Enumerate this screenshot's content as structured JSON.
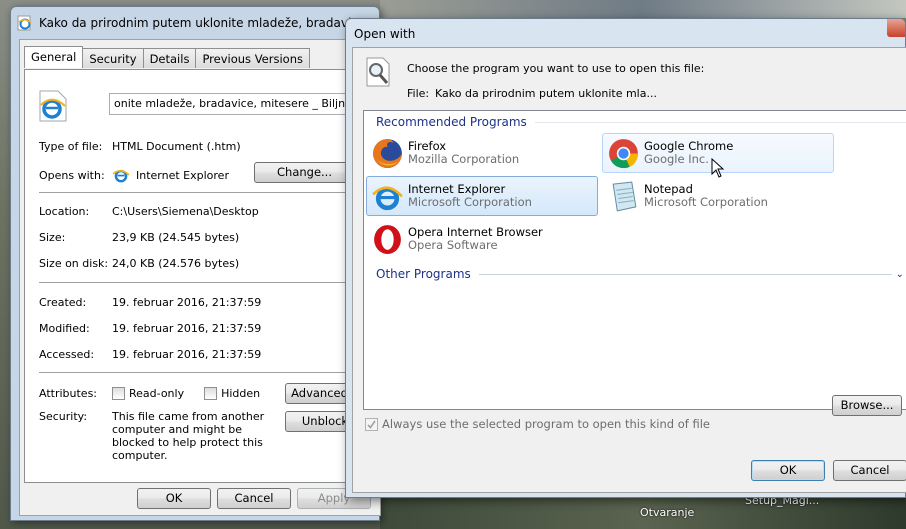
{
  "properties": {
    "title": "Kako da prirodnim putem uklonite mladeže, bradavic...",
    "tabs": [
      "General",
      "Security",
      "Details",
      "Previous Versions"
    ],
    "file_name": "onite mladeže, bradavice, mitesere _ Biljna apoteka",
    "type_label": "Type of file:",
    "type_value": "HTML Document (.htm)",
    "opens_label": "Opens with:",
    "opens_value": "Internet Explorer",
    "change_button": "Change...",
    "location_label": "Location:",
    "location_value": "C:\\Users\\Siemena\\Desktop",
    "size_label": "Size:",
    "size_value": "23,9 KB (24.545 bytes)",
    "size_disk_label": "Size on disk:",
    "size_disk_value": "24,0 KB (24.576 bytes)",
    "created_label": "Created:",
    "created_value": "19. februar 2016, 21:37:59",
    "modified_label": "Modified:",
    "modified_value": "19. februar 2016, 21:37:59",
    "accessed_label": "Accessed:",
    "accessed_value": "19. februar 2016, 21:37:59",
    "attributes_label": "Attributes:",
    "readonly_label": "Read-only",
    "hidden_label": "Hidden",
    "advanced_button": "Advanced...",
    "security_label": "Security:",
    "security_text": "This file came from another computer and might be blocked to help protect this computer.",
    "unblock_button": "Unblock",
    "ok_button": "OK",
    "cancel_button": "Cancel",
    "apply_button": "Apply"
  },
  "open_with": {
    "title": "Open with",
    "instruction": "Choose the program you want to use to open this file:",
    "file_label": "File:",
    "file_value": "Kako da prirodnim putem uklonite mla...",
    "recommended_header": "Recommended Programs",
    "other_header": "Other Programs",
    "programs": [
      {
        "name": "Firefox",
        "company": "Mozilla Corporation",
        "icon": "firefox-icon"
      },
      {
        "name": "Google Chrome",
        "company": "Google Inc.",
        "icon": "chrome-icon"
      },
      {
        "name": "Internet Explorer",
        "company": "Microsoft Corporation",
        "icon": "ie-icon"
      },
      {
        "name": "Notepad",
        "company": "Microsoft Corporation",
        "icon": "notepad-icon"
      },
      {
        "name": "Opera Internet Browser",
        "company": "Opera Software",
        "icon": "opera-icon"
      }
    ],
    "always_label": "Always use the selected program to open this kind of file",
    "browse_button": "Browse...",
    "ok_button": "OK",
    "cancel_button": "Cancel"
  },
  "desktop": {
    "labels": [
      "Otvaranje",
      "Setup_Magi..."
    ]
  }
}
